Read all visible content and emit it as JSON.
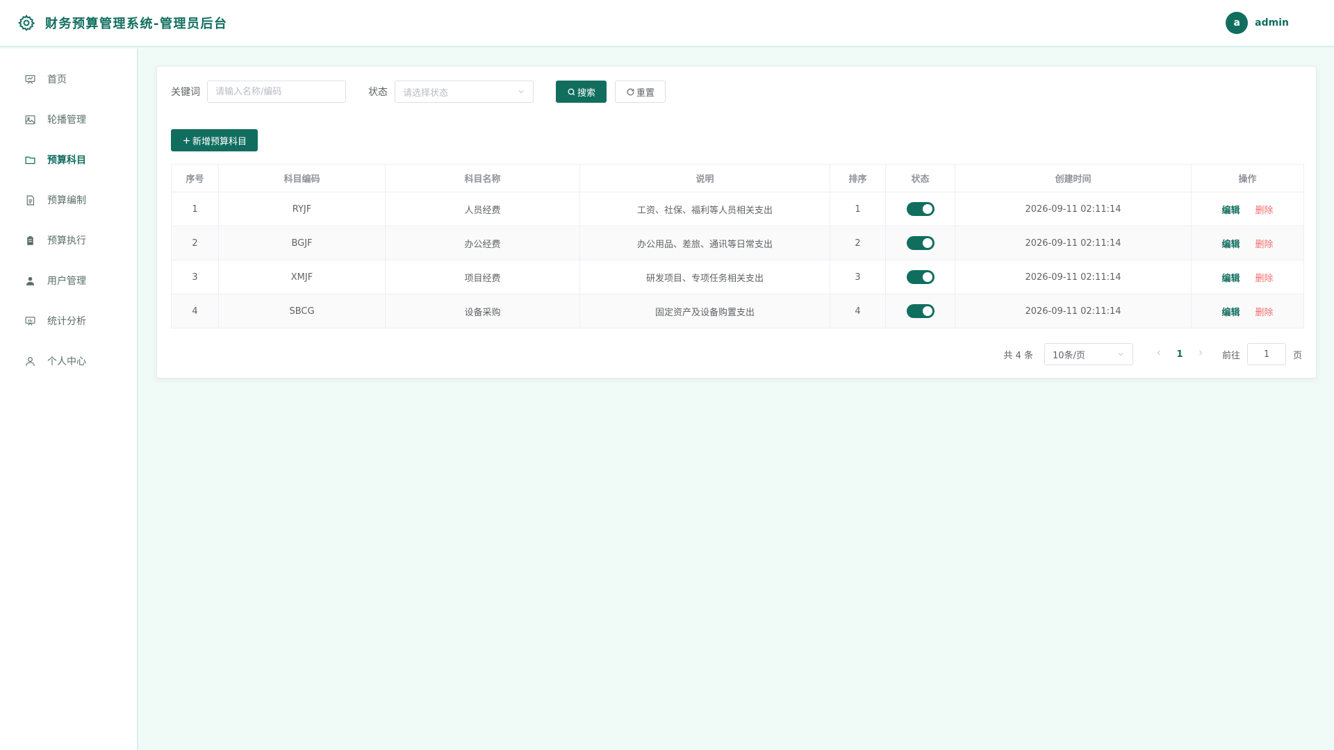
{
  "header": {
    "title": "财务预算管理系统-管理员后台",
    "avatar_letter": "a",
    "username": "admin",
    "logo_icon": "gear-icon"
  },
  "sidebar": {
    "items": [
      {
        "label": "首页",
        "icon": "dashboard-icon",
        "active": false
      },
      {
        "label": "轮播管理",
        "icon": "image-icon",
        "active": false
      },
      {
        "label": "预算科目",
        "icon": "folder-icon",
        "active": true
      },
      {
        "label": "预算编制",
        "icon": "document-icon",
        "active": false
      },
      {
        "label": "预算执行",
        "icon": "clipboard-icon",
        "active": false
      },
      {
        "label": "用户管理",
        "icon": "user-filled-icon",
        "active": false
      },
      {
        "label": "统计分析",
        "icon": "chart-board-icon",
        "active": false
      },
      {
        "label": "个人中心",
        "icon": "user-outline-icon",
        "active": false
      }
    ]
  },
  "search": {
    "keyword_label": "关键词",
    "keyword_placeholder": "请输入名称/编码",
    "keyword_value": "",
    "status_label": "状态",
    "status_placeholder": "请选择状态",
    "search_button": "搜索",
    "reset_button": "重置"
  },
  "actions": {
    "add_button": "新增预算科目"
  },
  "table": {
    "columns": [
      "序号",
      "科目编码",
      "科目名称",
      "说明",
      "排序",
      "状态",
      "创建时间",
      "操作"
    ],
    "rows": [
      {
        "index": "1",
        "code": "RYJF",
        "name": "人员经费",
        "desc": "工资、社保、福利等人员相关支出",
        "sort": "1",
        "enabled": true,
        "created": "2026-09-11 02:11:14"
      },
      {
        "index": "2",
        "code": "BGJF",
        "name": "办公经费",
        "desc": "办公用品、差旅、通讯等日常支出",
        "sort": "2",
        "enabled": true,
        "created": "2026-09-11 02:11:14"
      },
      {
        "index": "3",
        "code": "XMJF",
        "name": "项目经费",
        "desc": "研发项目、专项任务相关支出",
        "sort": "3",
        "enabled": true,
        "created": "2026-09-11 02:11:14"
      },
      {
        "index": "4",
        "code": "SBCG",
        "name": "设备采购",
        "desc": "固定资产及设备购置支出",
        "sort": "4",
        "enabled": true,
        "created": "2026-09-11 02:11:14"
      }
    ],
    "edit_label": "编辑",
    "delete_label": "删除"
  },
  "pagination": {
    "total_text": "共 4 条",
    "page_size": "10条/页",
    "current_page": "1",
    "goto_label": "前往",
    "jump_value": "1",
    "page_unit": "页"
  },
  "colors": {
    "primary": "#116e5f",
    "danger": "#f56c6c",
    "background": "#f0fbf8"
  }
}
